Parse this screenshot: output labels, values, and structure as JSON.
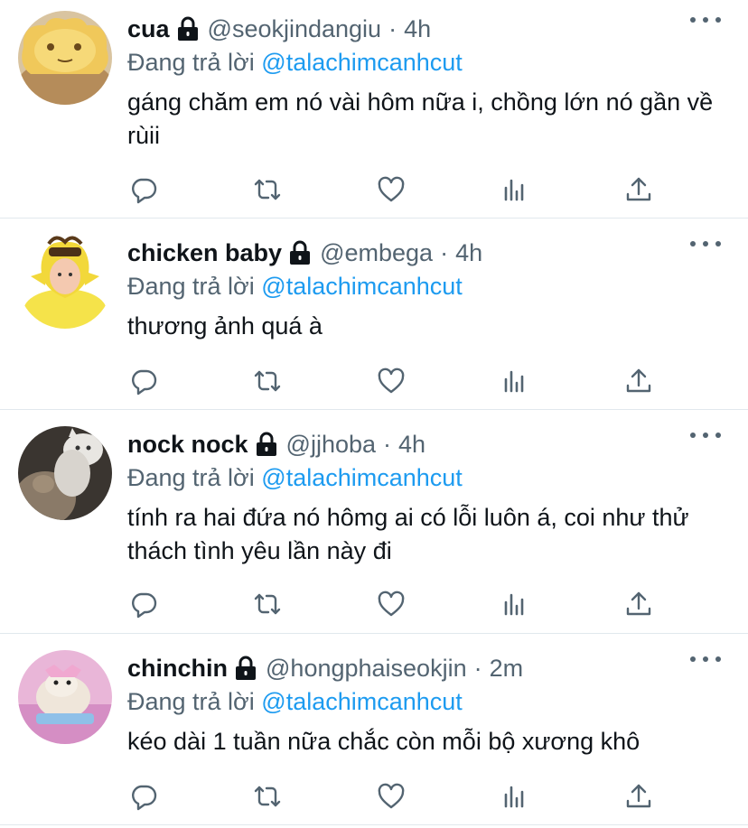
{
  "tweets": [
    {
      "name": "cua",
      "handle": "@seokjindangiu",
      "separator": "·",
      "time": "4h",
      "reply_prefix": "Đang trả lời",
      "reply_to": "@talachimcanhcut",
      "text": "gáng chăm em nó vài hôm nữa i, chồng lớn nó gần về rùii",
      "avatar": "avatar-yellow-crab-bread"
    },
    {
      "name": "chicken baby",
      "handle": "@embega",
      "separator": "·",
      "time": "4h",
      "reply_prefix": "Đang trả lời",
      "reply_to": "@talachimcanhcut",
      "text": "thương ảnh quá à",
      "avatar": "avatar-chick-costume"
    },
    {
      "name": "nock nock",
      "handle": "@jjhoba",
      "separator": "·",
      "time": "4h",
      "reply_prefix": "Đang trả lời",
      "reply_to": "@talachimcanhcut",
      "text": "tính ra hai đứa nó hômg ai có lỗi luôn á, coi như thử thách tình yêu lần này đi",
      "avatar": "avatar-cats"
    },
    {
      "name": "chinchin",
      "handle": "@hongphaiseokjin",
      "separator": "·",
      "time": "2m",
      "reply_prefix": "Đang trả lời",
      "reply_to": "@talachimcanhcut",
      "text": "kéo dài 1 tuần nữa chắc còn mỗi bộ xương khô",
      "avatar": "avatar-hamster-pink"
    }
  ],
  "icons": {
    "lock": "lock-icon",
    "more": "more-icon",
    "reply": "reply-icon",
    "retweet": "retweet-icon",
    "like": "like-icon",
    "analytics": "analytics-icon",
    "share": "share-icon"
  },
  "colors": {
    "link": "#1d9bf0",
    "secondary": "#536471",
    "text": "#0f1419",
    "divider": "#e1e8ed"
  }
}
